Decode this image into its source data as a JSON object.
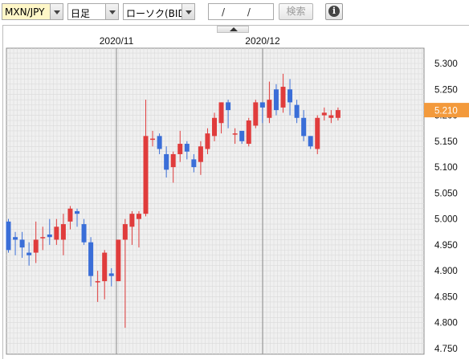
{
  "toolbar": {
    "symbol": "MXN/JPY",
    "period": "日足",
    "chart_type": "ローソク(BID)",
    "date_placeholder": "/ /",
    "search_label": "検索",
    "info_icon": "info-icon",
    "info_glyph": "i"
  },
  "colors": {
    "up": "#e03c3c",
    "down": "#3a6ed8",
    "price_tag": "#f39a3c"
  },
  "chart_data": {
    "type": "candlestick",
    "x_labels": [
      "2020/11",
      "2020/12"
    ],
    "y_ticks": [
      "5.300",
      "5.250",
      "5.200",
      "5.150",
      "5.100",
      "5.050",
      "5.000",
      "4.950",
      "4.900",
      "4.850",
      "4.800",
      "4.750"
    ],
    "ylim": [
      4.75,
      5.3
    ],
    "current_price": "5.210",
    "grid": true,
    "candles": [
      [
        4.995,
        4.94,
        5.0,
        4.935
      ],
      [
        4.965,
        4.96,
        4.975,
        4.93
      ],
      [
        4.96,
        4.945,
        4.975,
        4.925
      ],
      [
        4.935,
        4.93,
        4.955,
        4.91
      ],
      [
        4.935,
        4.96,
        4.995,
        4.915
      ],
      [
        4.965,
        4.965,
        4.985,
        4.94
      ],
      [
        4.97,
        4.965,
        5.0,
        4.95
      ],
      [
        4.96,
        4.985,
        5.0,
        4.95
      ],
      [
        4.96,
        4.99,
        5.01,
        4.93
      ],
      [
        4.995,
        5.02,
        5.025,
        4.98
      ],
      [
        5.015,
        5.01,
        5.02,
        4.985
      ],
      [
        4.99,
        4.955,
        5.0,
        4.95
      ],
      [
        4.955,
        4.89,
        4.965,
        4.87
      ],
      [
        4.88,
        4.88,
        4.9,
        4.84
      ],
      [
        4.88,
        4.935,
        4.94,
        4.845
      ],
      [
        4.895,
        4.89,
        4.905,
        4.87
      ],
      [
        4.88,
        4.96,
        4.96,
        4.88
      ],
      [
        4.96,
        4.99,
        5.0,
        4.79
      ],
      [
        4.985,
        5.01,
        5.015,
        4.95
      ],
      [
        5.0,
        5.01,
        5.015,
        4.945
      ],
      [
        5.01,
        5.16,
        5.23,
        5.005
      ],
      [
        5.155,
        5.155,
        5.17,
        5.14
      ],
      [
        5.16,
        5.135,
        5.165,
        5.125
      ],
      [
        5.125,
        5.095,
        5.14,
        5.08
      ],
      [
        5.1,
        5.125,
        5.13,
        5.07
      ],
      [
        5.125,
        5.145,
        5.17,
        5.11
      ],
      [
        5.145,
        5.13,
        5.15,
        5.115
      ],
      [
        5.115,
        5.1,
        5.125,
        5.09
      ],
      [
        5.11,
        5.14,
        5.15,
        5.085
      ],
      [
        5.135,
        5.165,
        5.175,
        5.125
      ],
      [
        5.16,
        5.195,
        5.205,
        5.15
      ],
      [
        5.185,
        5.225,
        5.225,
        5.165
      ],
      [
        5.225,
        5.21,
        5.23,
        5.175
      ],
      [
        5.165,
        5.165,
        5.175,
        5.145
      ],
      [
        5.17,
        5.15,
        5.16,
        5.145
      ],
      [
        5.145,
        5.19,
        5.195,
        5.14
      ],
      [
        5.18,
        5.225,
        5.23,
        5.175
      ],
      [
        5.225,
        5.215,
        5.225,
        5.185
      ],
      [
        5.195,
        5.23,
        5.265,
        5.185
      ],
      [
        5.25,
        5.21,
        5.26,
        5.2
      ],
      [
        5.215,
        5.255,
        5.28,
        5.205
      ],
      [
        5.25,
        5.225,
        5.27,
        5.2
      ],
      [
        5.22,
        5.195,
        5.23,
        5.185
      ],
      [
        5.195,
        5.16,
        5.21,
        5.15
      ],
      [
        5.16,
        5.14,
        5.16,
        5.135
      ],
      [
        5.135,
        5.195,
        5.2,
        5.125
      ],
      [
        5.2,
        5.205,
        5.215,
        5.19
      ],
      [
        5.195,
        5.2,
        5.21,
        5.185
      ],
      [
        5.195,
        5.21,
        5.215,
        5.19
      ]
    ]
  }
}
